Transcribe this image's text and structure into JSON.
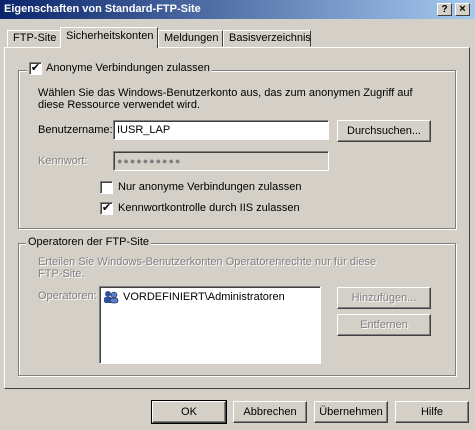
{
  "window": {
    "title": "Eigenschaften von Standard-FTP-Site",
    "help_button": "?",
    "close_button": "×"
  },
  "tabs": [
    {
      "label": "FTP-Site"
    },
    {
      "label": "Sicherheitskonten"
    },
    {
      "label": "Meldungen"
    },
    {
      "label": "Basisverzeichnis"
    }
  ],
  "anon_group": {
    "checkbox_label": "Anonyme Verbindungen zulassen",
    "checked": "✔",
    "description_line1": "Wählen Sie das Windows-Benutzerkonto aus, das zum anonymen Zugriff auf",
    "description_line2": "diese Ressource verwendet wird.",
    "username_label": "Benutzername:",
    "username_value": "IUSR_LAP",
    "browse_button": "Durchsuchen...",
    "password_label": "Kennwort:",
    "password_value": "●●●●●●●●●●",
    "only_anon_label": "Nur anonyme Verbindungen zulassen",
    "iis_password_label": "Kennwortkontrolle durch IIS zulassen",
    "iis_checked": "✔"
  },
  "operators_group": {
    "legend": "Operatoren der FTP-Site",
    "description_line1": "Erteilen Sie Windows-Benutzerkonten Operatorenrechte nur für diese",
    "description_line2": "FTP-Site.",
    "operators_label": "Operatoren:",
    "items": [
      "VORDEFINIERT\\Administratoren"
    ],
    "add_button": "Hinzufügen...",
    "remove_button": "Entfernen"
  },
  "footer": {
    "ok": "OK",
    "cancel": "Abbrechen",
    "apply": "Übernehmen",
    "help": "Hilfe"
  }
}
